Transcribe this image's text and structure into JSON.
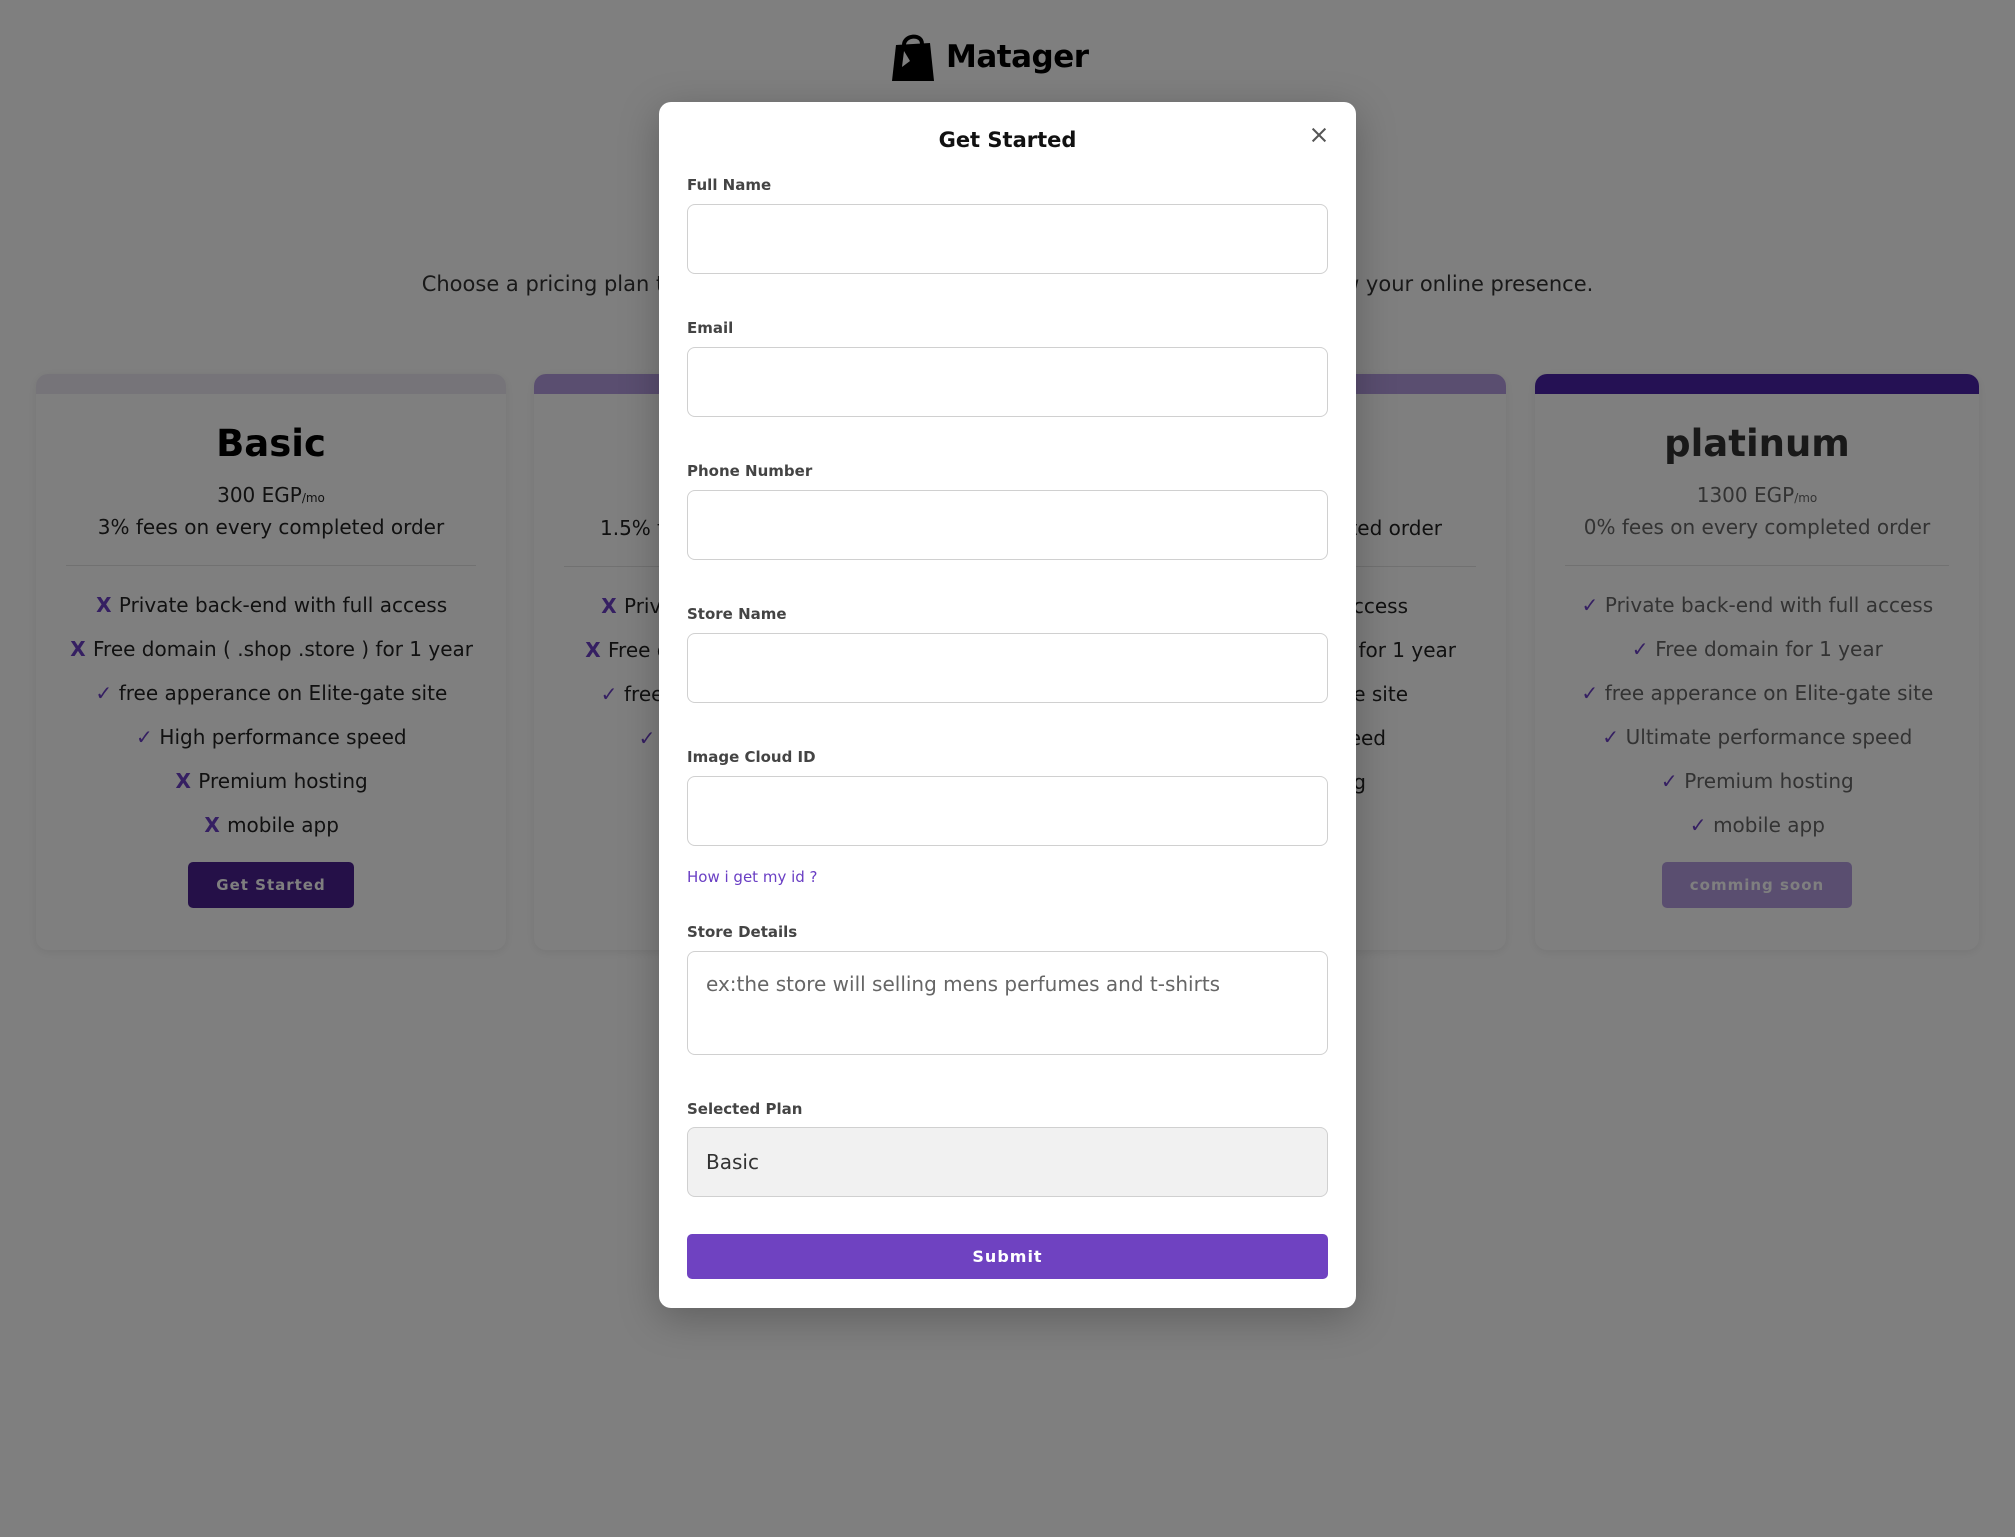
{
  "brand": {
    "logo_text": "Matager",
    "logo_icon": "shopping-bag-icon"
  },
  "hero": {
    "subtitle": "Choose a pricing plan that fits your business needs and unlock powerful features to grow your online presence."
  },
  "colors": {
    "accent": "#6f42c1",
    "mark": "#6a3fc4",
    "bar_basic": "#ece8f3",
    "bar_mid": "#b49ce0",
    "bar_platinum": "#4b23a8",
    "btn_dark": "#4b2191"
  },
  "plans": [
    {
      "title": "Basic",
      "price": "300 EGP",
      "per": "/mo",
      "fees": "3% fees on every completed order",
      "features": [
        {
          "mark": "X",
          "text": "Private back-end with full access"
        },
        {
          "mark": "X",
          "text": "Free domain ( .shop .store ) for 1 year"
        },
        {
          "mark": "✓",
          "text": "free apperance on Elite-gate site"
        },
        {
          "mark": "✓",
          "text": "High performance speed"
        },
        {
          "mark": "X",
          "text": "Premium hosting"
        },
        {
          "mark": "X",
          "text": "mobile app"
        }
      ],
      "button": "Get Started"
    },
    {
      "title": "",
      "price": "",
      "per": "",
      "fees": "1.5% fe",
      "features": [
        {
          "mark": "X",
          "text": "Priv"
        },
        {
          "mark": "X",
          "text": "Free d"
        },
        {
          "mark": "✓",
          "text": "free"
        },
        {
          "mark": "✓",
          "text": ""
        }
      ],
      "button": ""
    },
    {
      "title": "",
      "price": "",
      "per": "",
      "fees": "ted order",
      "features": [
        {
          "mark": "",
          "text": "ll access"
        },
        {
          "mark": "",
          "text": ") for 1 year"
        },
        {
          "mark": "",
          "text": "gate site"
        },
        {
          "mark": "",
          "text": "peed"
        },
        {
          "mark": "",
          "text": "g"
        }
      ],
      "button": ""
    },
    {
      "title": "platinum",
      "price": "1300 EGP",
      "per": "/mo",
      "fees": "0% fees on every completed order",
      "features": [
        {
          "mark": "✓",
          "text": "Private back-end with full access"
        },
        {
          "mark": "✓",
          "text": "Free domain for 1 year"
        },
        {
          "mark": "✓",
          "text": "free apperance on Elite-gate site"
        },
        {
          "mark": "✓",
          "text": "Ultimate performance speed"
        },
        {
          "mark": "✓",
          "text": "Premium hosting"
        },
        {
          "mark": "✓",
          "text": "mobile app"
        }
      ],
      "button": "comming soon"
    }
  ],
  "modal": {
    "title": "Get Started",
    "close_icon": "close-icon",
    "fields": {
      "full_name": {
        "label": "Full Name",
        "value": ""
      },
      "email": {
        "label": "Email",
        "value": ""
      },
      "phone": {
        "label": "Phone Number",
        "value": ""
      },
      "store_name": {
        "label": "Store Name",
        "value": ""
      },
      "image_cloud_id": {
        "label": "Image Cloud ID",
        "value": ""
      },
      "store_details": {
        "label": "Store Details",
        "placeholder": "ex:the store will selling mens perfumes and t-shirts"
      },
      "selected_plan": {
        "label": "Selected Plan",
        "value": "Basic"
      }
    },
    "help_link": "How i get my id ?",
    "submit": "Submit"
  }
}
